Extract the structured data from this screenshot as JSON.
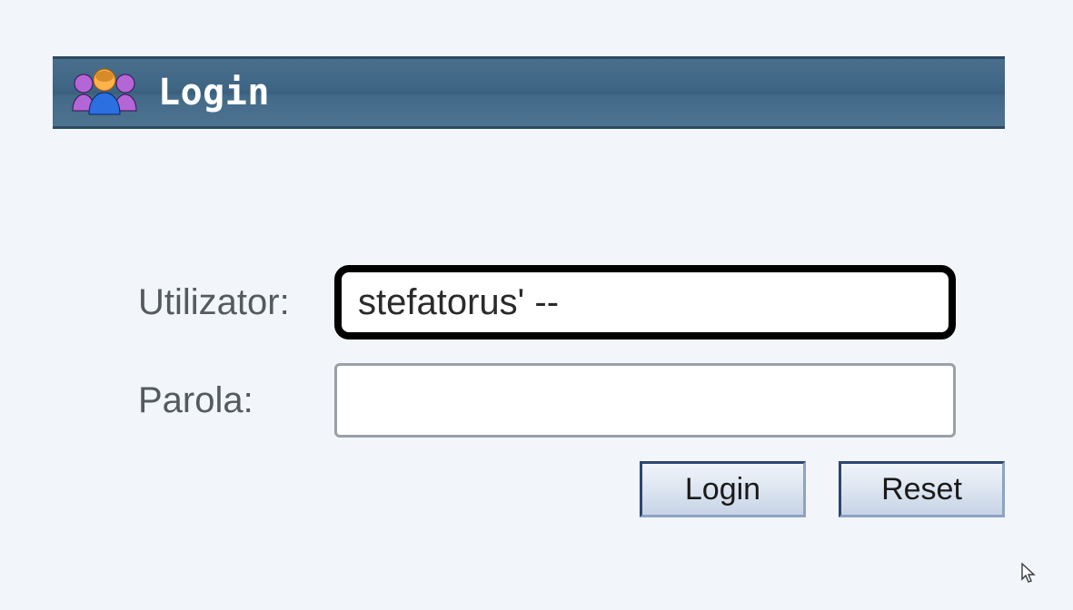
{
  "header": {
    "title": "Login",
    "icon": "users-icon"
  },
  "form": {
    "username_label": "Utilizator:",
    "password_label": "Parola:",
    "username_value": "stefatorus' --",
    "password_value": ""
  },
  "buttons": {
    "login_label": "Login",
    "reset_label": "Reset"
  }
}
